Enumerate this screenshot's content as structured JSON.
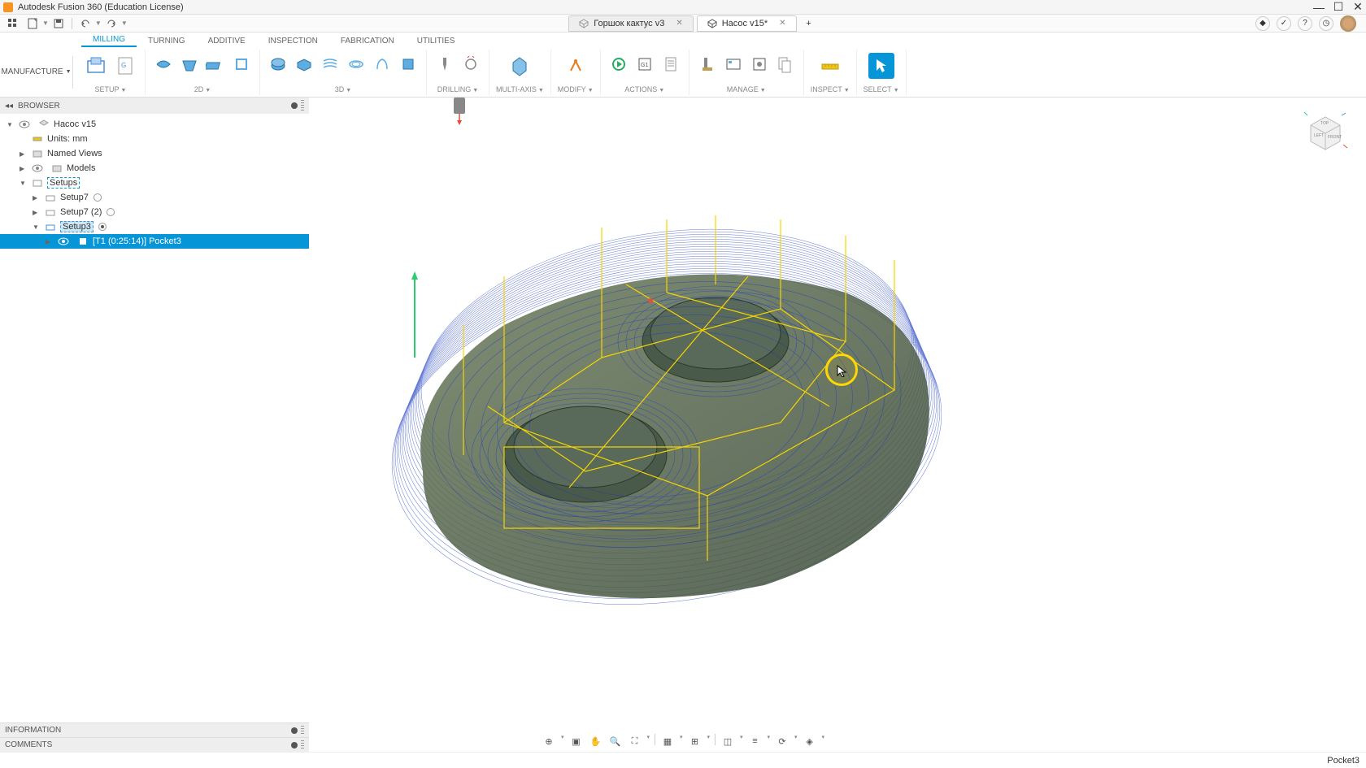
{
  "app": {
    "title": "Autodesk Fusion 360 (Education License)"
  },
  "tabs": [
    {
      "label": "Горшок кактус v3",
      "active": false
    },
    {
      "label": "Насос v15*",
      "active": true
    }
  ],
  "ribbon_tabs": [
    {
      "label": "MILLING",
      "active": true
    },
    {
      "label": "TURNING",
      "active": false
    },
    {
      "label": "ADDITIVE",
      "active": false
    },
    {
      "label": "INSPECTION",
      "active": false
    },
    {
      "label": "FABRICATION",
      "active": false
    },
    {
      "label": "UTILITIES",
      "active": false
    }
  ],
  "workspace": {
    "label": "MANUFACTURE"
  },
  "ribbon_groups": {
    "setup": "SETUP",
    "g2d": "2D",
    "g3d": "3D",
    "drilling": "DRILLING",
    "multiaxis": "MULTI-AXIS",
    "modify": "MODIFY",
    "actions": "ACTIONS",
    "manage": "MANAGE",
    "inspect": "INSPECT",
    "select": "SELECT"
  },
  "browser": {
    "title": "BROWSER",
    "root": "Насос v15",
    "units": "Units: mm",
    "named_views": "Named Views",
    "models": "Models",
    "setups": "Setups",
    "setup7": "Setup7",
    "setup7_2": "Setup7 (2)",
    "setup3": "Setup3",
    "operation": "[T1 (0:25:14)] Pocket3"
  },
  "panels": {
    "information": "INFORMATION",
    "comments": "COMMENTS"
  },
  "status": {
    "right": "Pocket3"
  },
  "viewcube": {
    "top": "TOP",
    "left": "LEFT",
    "front": "FRONT"
  }
}
